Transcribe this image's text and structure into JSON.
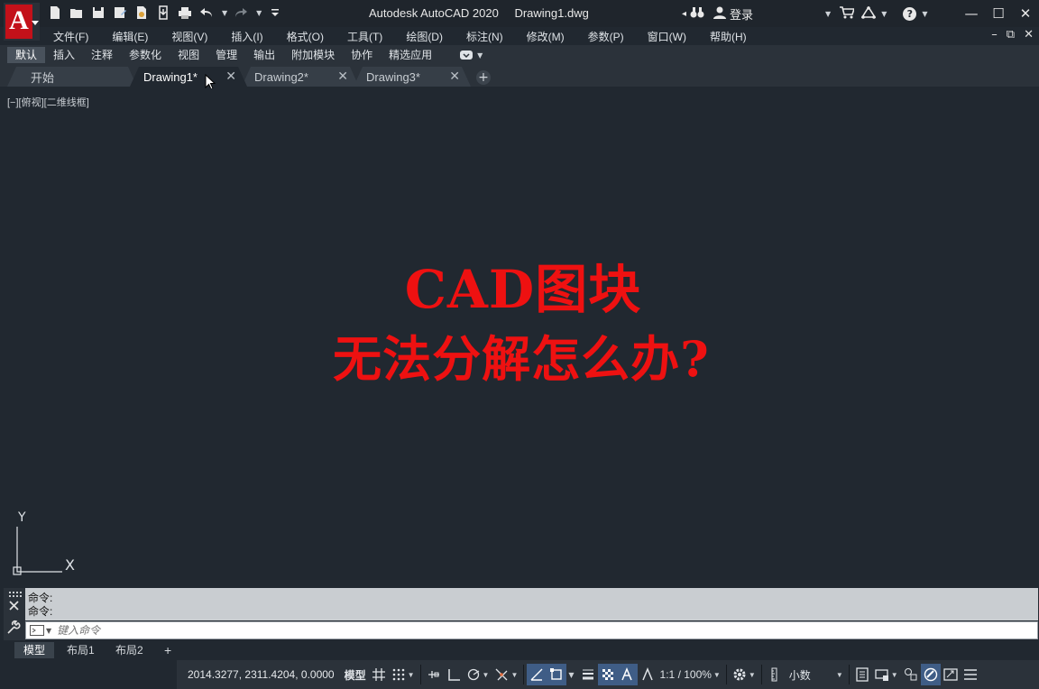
{
  "titlebar": {
    "app": "Autodesk AutoCAD 2020",
    "file": "Drawing1.dwg",
    "login": "登录",
    "help": "?"
  },
  "menu": [
    "文件(F)",
    "编辑(E)",
    "视图(V)",
    "插入(I)",
    "格式(O)",
    "工具(T)",
    "绘图(D)",
    "标注(N)",
    "修改(M)",
    "参数(P)",
    "窗口(W)",
    "帮助(H)"
  ],
  "ribbon_tabs": [
    "默认",
    "插入",
    "注释",
    "参数化",
    "视图",
    "管理",
    "输出",
    "附加模块",
    "协作",
    "精选应用"
  ],
  "file_tabs": {
    "start": "开始",
    "drawings": [
      "Drawing1*",
      "Drawing2*",
      "Drawing3*"
    ],
    "active": "Drawing1*"
  },
  "viewport": {
    "label": "[−][俯视][二维线框]",
    "ucs_y": "Y",
    "ucs_x": "X"
  },
  "overlay": {
    "line1": "CAD图块",
    "line2": "无法分解怎么办?",
    "color": "#ee1111"
  },
  "command": {
    "history": [
      "命令:",
      "命令:"
    ],
    "placeholder": "键入命令"
  },
  "layout_tabs": [
    "模型",
    "布局1",
    "布局2"
  ],
  "status": {
    "coords": "2014.3277, 2311.4204, 0.0000",
    "model": "模型",
    "scale": "1:1 / 100%",
    "units": "小数"
  },
  "colors": {
    "background": "#212830",
    "accent_active": "#3f5d86",
    "logo_red": "#c3111a"
  }
}
